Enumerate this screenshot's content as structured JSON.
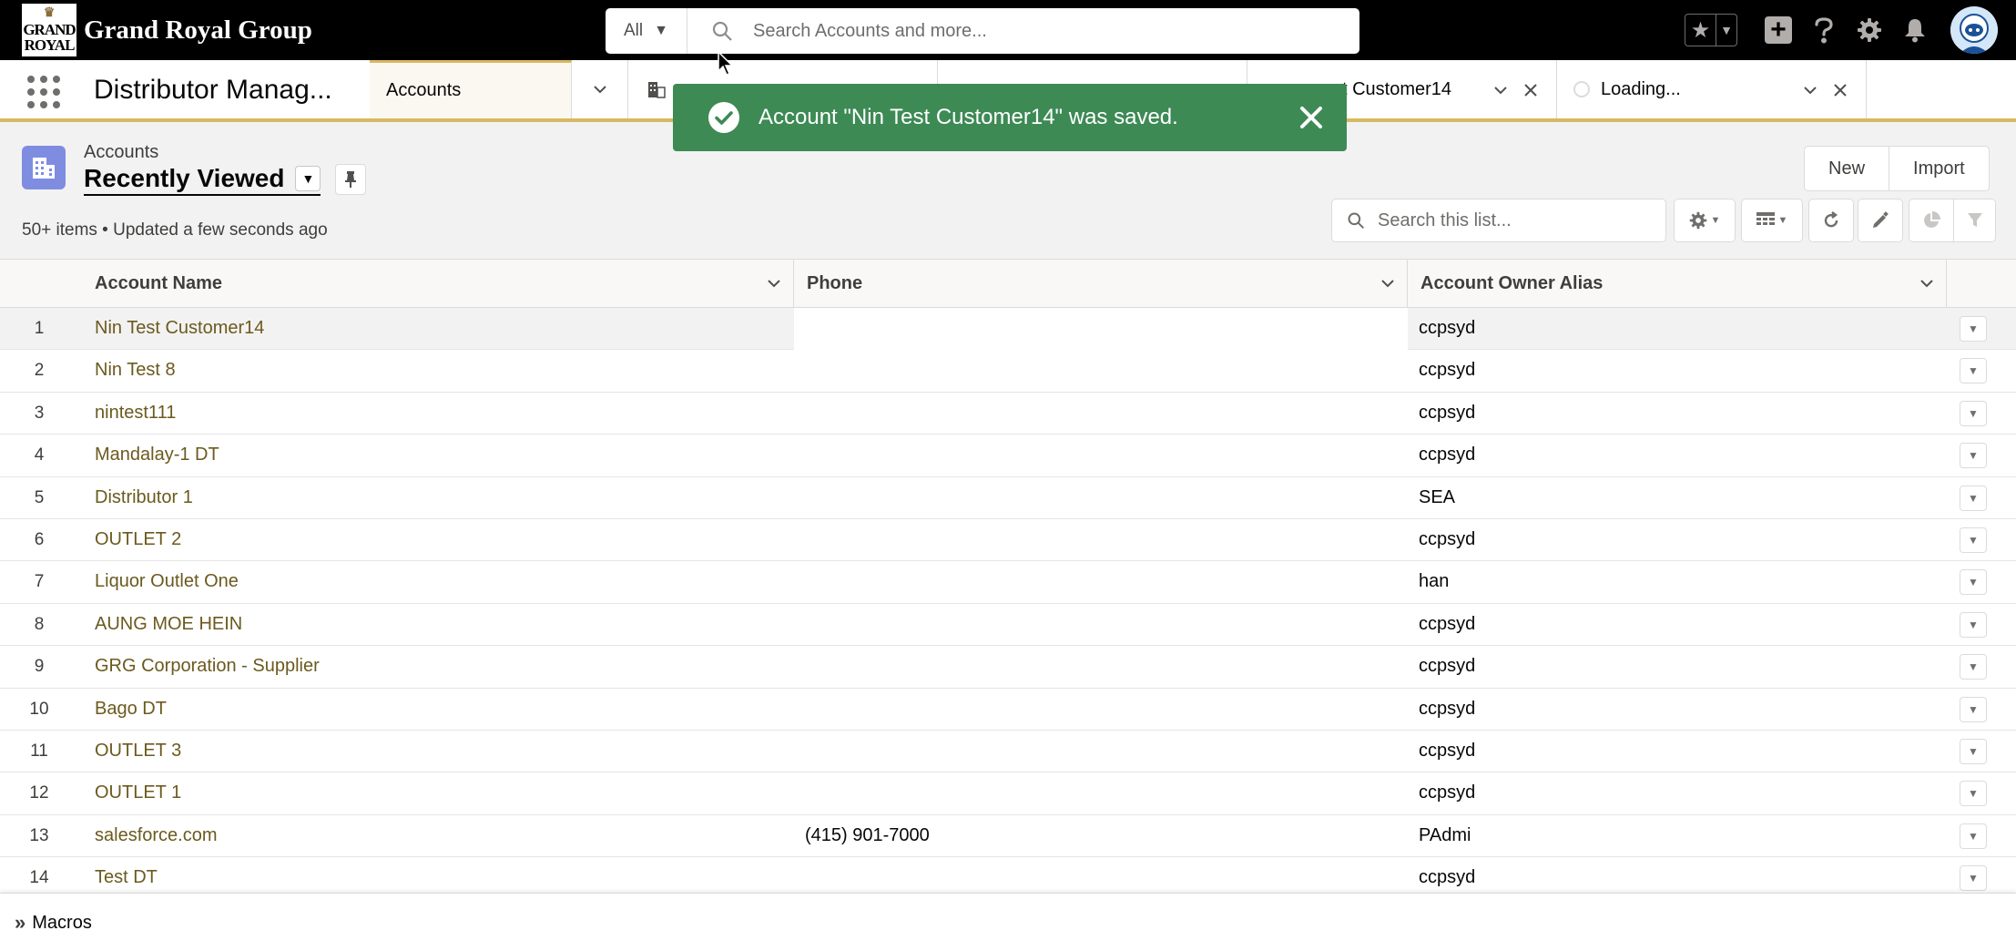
{
  "brand": {
    "logo_line1": "GRAND",
    "logo_line2": "ROYAL",
    "name": "Grand Royal Group"
  },
  "global_search": {
    "scope": "All",
    "placeholder": "Search Accounts and more..."
  },
  "app_nav": {
    "app_name": "Distributor Manag...",
    "tabs": [
      {
        "label": "Accounts",
        "active": true
      },
      {
        "label": "",
        "active": false
      },
      {
        "label": "st Customer14",
        "active": false
      },
      {
        "label": "Loading...",
        "active": false
      }
    ]
  },
  "toast": {
    "message": "Account \"Nin Test Customer14\" was saved.",
    "color": "#3d8a55"
  },
  "list_header": {
    "object_label": "Accounts",
    "view_name": "Recently Viewed",
    "meta": "50+ items • Updated a few seconds ago",
    "buttons": {
      "new": "New",
      "import": "Import"
    },
    "search_placeholder": "Search this list..."
  },
  "table": {
    "columns": [
      "Account Name",
      "Phone",
      "Account Owner Alias"
    ],
    "rows": [
      {
        "num": "1",
        "name": "Nin Test Customer14",
        "phone": "",
        "owner": "ccpsyd"
      },
      {
        "num": "2",
        "name": "Nin Test 8",
        "phone": "",
        "owner": "ccpsyd"
      },
      {
        "num": "3",
        "name": "nintest111",
        "phone": "",
        "owner": "ccpsyd"
      },
      {
        "num": "4",
        "name": "Mandalay-1 DT",
        "phone": "",
        "owner": "ccpsyd"
      },
      {
        "num": "5",
        "name": "Distributor 1",
        "phone": "",
        "owner": "SEA"
      },
      {
        "num": "6",
        "name": "OUTLET 2",
        "phone": "",
        "owner": "ccpsyd"
      },
      {
        "num": "7",
        "name": "Liquor Outlet One",
        "phone": "",
        "owner": "han"
      },
      {
        "num": "8",
        "name": "AUNG MOE HEIN",
        "phone": "",
        "owner": "ccpsyd"
      },
      {
        "num": "9",
        "name": "GRG Corporation - Supplier",
        "phone": "",
        "owner": "ccpsyd"
      },
      {
        "num": "10",
        "name": "Bago DT",
        "phone": "",
        "owner": "ccpsyd"
      },
      {
        "num": "11",
        "name": "OUTLET 3",
        "phone": "",
        "owner": "ccpsyd"
      },
      {
        "num": "12",
        "name": "OUTLET 1",
        "phone": "",
        "owner": "ccpsyd"
      },
      {
        "num": "13",
        "name": "salesforce.com",
        "phone": "(415) 901-7000",
        "owner": "PAdmi"
      },
      {
        "num": "14",
        "name": "Test DT",
        "phone": "",
        "owner": "ccpsyd"
      }
    ]
  },
  "utility_bar": {
    "macros_label": "Macros"
  },
  "colors": {
    "accent": "#d8b862",
    "link": "#6b5a1e",
    "object_icon": "#7f8de1"
  },
  "icons": {
    "search": "search-icon",
    "favorites": "star-icon",
    "add": "plus-icon",
    "help": "question-icon",
    "settings": "gear-icon",
    "notifications": "bell-icon",
    "toast_check": "success-check-icon",
    "toast_close": "close-icon"
  }
}
